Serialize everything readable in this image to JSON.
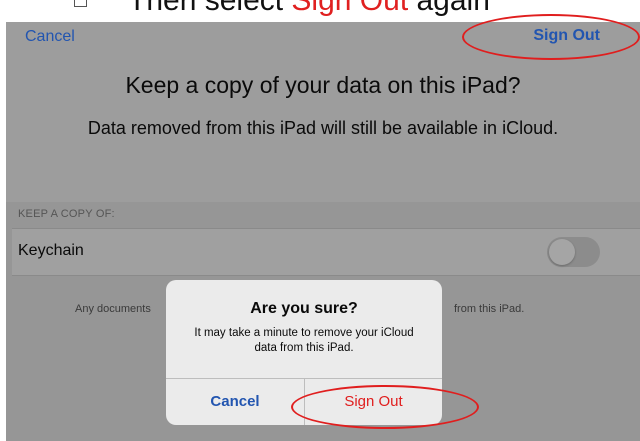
{
  "caption": {
    "prefix": "Then select ",
    "highlight": "Sign Out",
    "suffix": " again"
  },
  "nav": {
    "cancel": "Cancel",
    "sign_out": "Sign Out"
  },
  "main": {
    "title": "Keep a copy of your data on this iPad?",
    "subtitle": "Data removed from this iPad will still be available in iCloud."
  },
  "section": {
    "header": "KEEP A COPY OF:",
    "rows": [
      {
        "label": "Keychain",
        "toggle_on": false
      }
    ],
    "footer_left": "Any documents",
    "footer_right": "from this iPad."
  },
  "alert": {
    "title": "Are you sure?",
    "message": "It may take a minute to remove your iCloud data from this iPad.",
    "cancel": "Cancel",
    "sign_out": "Sign Out"
  },
  "colors": {
    "link_blue": "#2255b0",
    "destructive_red": "#e01e1e",
    "annotation_red": "#e01e1e"
  }
}
